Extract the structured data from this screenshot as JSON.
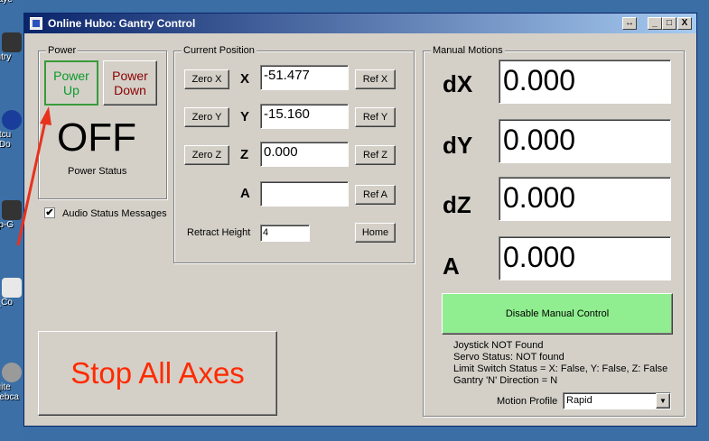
{
  "desktop": {
    "icons": [
      {
        "label": "playe"
      },
      {
        "label": "antry"
      },
      {
        "label": "ortcu reDo"
      },
      {
        "label": "tap-G"
      },
      {
        "label": "o_Co"
      },
      {
        "label": "ogite Webca"
      }
    ]
  },
  "window": {
    "title": "Online Hubo: Gantry Control",
    "controls": {
      "restore": "↔",
      "minimize": "_",
      "maximize": "□",
      "close": "X"
    }
  },
  "power": {
    "group_label": "Power",
    "up_label": "Power Up",
    "down_label": "Power Down",
    "state": "OFF",
    "status_label": "Power Status",
    "up_color": "#0a9a2a",
    "down_color": "#8b0000"
  },
  "audio": {
    "label": "Audio Status Messages",
    "checked": true
  },
  "current_position": {
    "group_label": "Current Position",
    "axes": [
      {
        "zero_label": "Zero X",
        "axis": "X",
        "value": "-51.477",
        "ref_label": "Ref X"
      },
      {
        "zero_label": "Zero Y",
        "axis": "Y",
        "value": "-15.160",
        "ref_label": "Ref Y"
      },
      {
        "zero_label": "Zero Z",
        "axis": "Z",
        "value": "0.000",
        "ref_label": "Ref Z"
      },
      {
        "axis": "A",
        "value": "",
        "ref_label": "Ref A"
      }
    ],
    "retract_label": "Retract Height",
    "retract_value": "4",
    "home_label": "Home"
  },
  "manual_motions": {
    "group_label": "Manual Motions",
    "rows": [
      {
        "label": "dX",
        "value": "0.000"
      },
      {
        "label": "dY",
        "value": "0.000"
      },
      {
        "label": "dZ",
        "value": "0.000"
      },
      {
        "label": "A",
        "value": "0.000"
      }
    ],
    "disable_label": "Disable Manual Control",
    "disable_color": "#90ee90",
    "status_lines": [
      "Joystick NOT Found",
      "Servo Status: NOT found",
      "Limit Switch Status = X: False, Y: False, Z: False",
      "Gantry 'N' Direction = N"
    ],
    "profile_label": "Motion Profile",
    "profile_value": "Rapid"
  },
  "stop": {
    "label": "Stop All Axes",
    "color": "#ff2a00"
  },
  "annotation": {
    "arrow_color": "#e8321e"
  }
}
